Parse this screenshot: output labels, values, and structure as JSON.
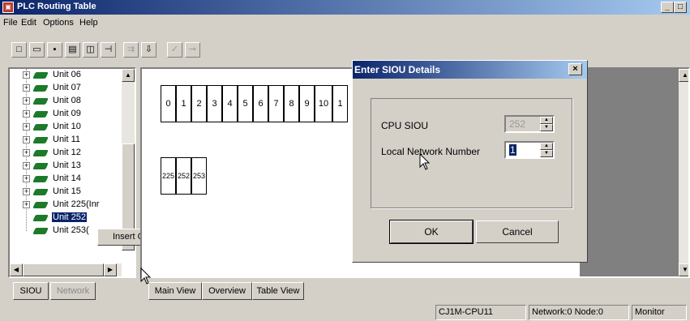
{
  "window": {
    "title": "PLC Routing Table",
    "minimize": "_",
    "maximize": "□",
    "close": "×"
  },
  "menu": [
    "File",
    "Edit",
    "Options",
    "Help"
  ],
  "tree": {
    "items": [
      {
        "label": "Unit 06",
        "expandable": true
      },
      {
        "label": "Unit 07",
        "expandable": true
      },
      {
        "label": "Unit 08",
        "expandable": true
      },
      {
        "label": "Unit 09",
        "expandable": true
      },
      {
        "label": "Unit 10",
        "expandable": true
      },
      {
        "label": "Unit 11",
        "expandable": true
      },
      {
        "label": "Unit 12",
        "expandable": true
      },
      {
        "label": "Unit 13",
        "expandable": true
      },
      {
        "label": "Unit 14",
        "expandable": true
      },
      {
        "label": "Unit 15",
        "expandable": true
      },
      {
        "label": "Unit 225(Inr",
        "expandable": true
      },
      {
        "label": "Unit 252",
        "expandable": false,
        "selected": true
      },
      {
        "label": "Unit 253(",
        "expandable": false
      }
    ]
  },
  "context_menu": {
    "item": "Insert CPU SIOU"
  },
  "left_tabs": [
    "SIOU",
    "Network"
  ],
  "main_tabs": [
    "Main View",
    "Overview",
    "Table View"
  ],
  "slots_row1": [
    "0",
    "1",
    "2",
    "3",
    "4",
    "5",
    "6",
    "7",
    "8",
    "9",
    "10",
    "1"
  ],
  "slots_row2": [
    "225",
    "252",
    "253"
  ],
  "dialog": {
    "title": "Enter SIOU Details",
    "close": "×",
    "cpu_siou_label": "CPU SIOU",
    "cpu_siou_value": "252",
    "local_network_label": "Local Network Number",
    "local_network_value": "1",
    "ok": "OK",
    "cancel": "Cancel"
  },
  "status": {
    "cpu": "CJ1M-CPU11",
    "network": "Network:0 Node:0",
    "mode": "Monitor"
  }
}
